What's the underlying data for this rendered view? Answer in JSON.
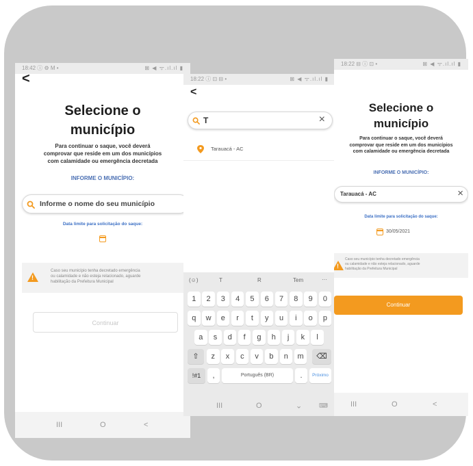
{
  "screen1": {
    "status_time": "18:42 ⓘ ⚙ M •",
    "status_icons": "⊠ ◀ ᯤ.ıl.ıl ▮",
    "back": "<",
    "title_line1": "Selecione o",
    "title_line2": "município",
    "desc_line1": "Para continuar o saque, você deverá",
    "desc_line2": "comprovar que reside em um dos municípios",
    "desc_line3": "com calamidade ou emergência decretada",
    "inform_label": "INFORME O MUNICÍPIO:",
    "search_placeholder": "Informe o nome do seu município",
    "date_limit_label": "Data limite para solicitação do saque:",
    "warning_line1": "Caso seu município tenha decretado emergência",
    "warning_line2": "ou calamidade e não esteja relacionado, aguarde",
    "warning_line3": "habilitação da Prefeitura Municipal",
    "button_label": "Continuar",
    "nav_recent": "III",
    "nav_home": "O",
    "nav_back": "<"
  },
  "screen2": {
    "status_time": "18:22 ⓘ ⊡ ⊟ •",
    "status_icons": "⊠ ◀ ᯤ.ıl.ıl ▮",
    "back": "<",
    "search_value": "T",
    "clear_icon": "×",
    "result_label": "Tarauacá - AC",
    "suggestions": [
      "T",
      "R",
      "Tem",
      "···"
    ],
    "row_numbers": [
      "1",
      "2",
      "3",
      "4",
      "5",
      "6",
      "7",
      "8",
      "9",
      "0"
    ],
    "row_top": [
      "q",
      "w",
      "e",
      "r",
      "t",
      "y",
      "u",
      "i",
      "o",
      "p"
    ],
    "row_mid": [
      "a",
      "s",
      "d",
      "f",
      "g",
      "h",
      "j",
      "k",
      "l"
    ],
    "row_low": [
      "z",
      "x",
      "c",
      "v",
      "b",
      "n",
      "m"
    ],
    "symbols_key": "!#1",
    "comma_key": ",",
    "space_key": "Português (BR)",
    "period_key": ".",
    "next_key": "Próximo",
    "nav_recent": "III",
    "nav_home": "O",
    "nav_down": "⌄"
  },
  "screen3": {
    "status_time": "18:22 ⊟ ⓘ ⊡ •",
    "status_icons": "⊠ ◀ ᯤ.ıl.ıl ▮",
    "title_line1": "Selecione o",
    "title_line2": "município",
    "desc_line1": "Para continuar o saque, você deverá",
    "desc_line2": "comprovar que reside em um dos municípios",
    "desc_line3": "com calamidade ou emergência decretada",
    "inform_label": "INFORME O MUNICÍPIO:",
    "selected_value": "Tarauacá - AC",
    "clear_icon": "×",
    "date_limit_label": "Data limite para solicitação do saque:",
    "date_value": "30/05/2021",
    "warning_line1": "Caso seu município tenha decretado emergência",
    "warning_line2": "ou calamidade e não esteja relacionado, aguarde",
    "warning_line3": "habilitação da Prefeitura Municipal",
    "button_label": "Continuar",
    "nav_recent": "III",
    "nav_home": "O",
    "nav_back": "<"
  },
  "colors": {
    "accent": "#f39a1f",
    "link_blue": "#4a6fb3",
    "frame_gray": "#c9c9c9"
  }
}
